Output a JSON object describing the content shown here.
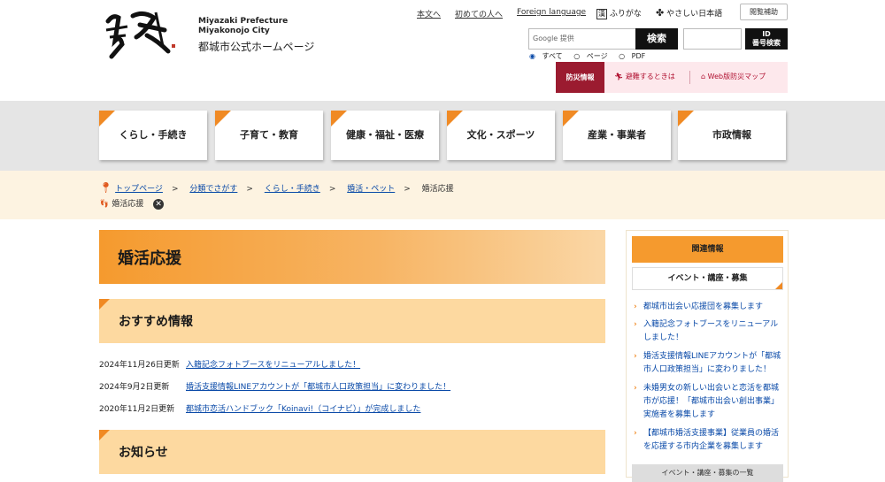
{
  "header": {
    "logo_alt": "都城",
    "pref_en": "Miyazaki Prefecture",
    "city_en": "Miyakonojo City",
    "site_title": "都城市公式ホームページ",
    "links": {
      "main_text": "本文へ",
      "first_time": "初めての人へ",
      "foreign": "Foreign language",
      "furigana": "ふりがな",
      "easy_japanese": "やさしい日本語",
      "assist": "閲覧補助"
    },
    "search": {
      "placeholder": "Google 提供",
      "button": "検索",
      "id_button_line1": "ID",
      "id_button_line2": "番号検索",
      "options": [
        "すべて",
        "ページ",
        "PDF"
      ]
    },
    "disaster": {
      "title": "防災情報",
      "evacuate": "避難するときは",
      "map": "Web版防災マップ"
    }
  },
  "nav": [
    "くらし・手続き",
    "子育て・教育",
    "健康・福祉・医療",
    "文化・スポーツ",
    "産業・事業者",
    "市政情報"
  ],
  "breadcrumb": {
    "items": [
      "トップページ",
      "分類でさがす",
      "くらし・手続き",
      "婚活・ペット"
    ],
    "current": "婚活応援",
    "sep": ">",
    "tag": "婚活応援",
    "tag_close": "✕"
  },
  "main": {
    "title": "婚活応援",
    "recommend_heading": "おすすめ情報",
    "recommend": [
      {
        "date": "2024年11月26日更新",
        "text": "入籍記念フォトブースをリニューアルしました！"
      },
      {
        "date": "2024年9月2日更新",
        "text": "婚活支援情報LINEアカウントが「都城市人口政策担当」に変わりました！"
      },
      {
        "date": "2020年11月2日更新",
        "text": "都城市恋活ハンドブック「Koinavi!（コイナビ）」が完成しました"
      }
    ],
    "news_heading": "お知らせ"
  },
  "sidebar": {
    "heading": "関連情報",
    "sub": "イベント・講座・募集",
    "links": [
      "都城市出会い応援団を募集します",
      "入籍記念フォトブースをリニューアルしました！",
      "婚活支援情報LINEアカウントが「都城市人口政策担当」に変わりました！",
      "未婚男女の新しい出会いと恋活を都城市が応援！「都城市出会い創出事業」実施者を募集します",
      "【都城市婚活支援事業】従業員の婚活を応援する市内企業を募集します"
    ],
    "more": "イベント・講座・募集の一覧"
  },
  "colors": {
    "accent": "#f08a24",
    "disaster": "#9b1b30",
    "nav_bg": "#e5e5e5",
    "crumb_bg": "#fdf3e1"
  }
}
